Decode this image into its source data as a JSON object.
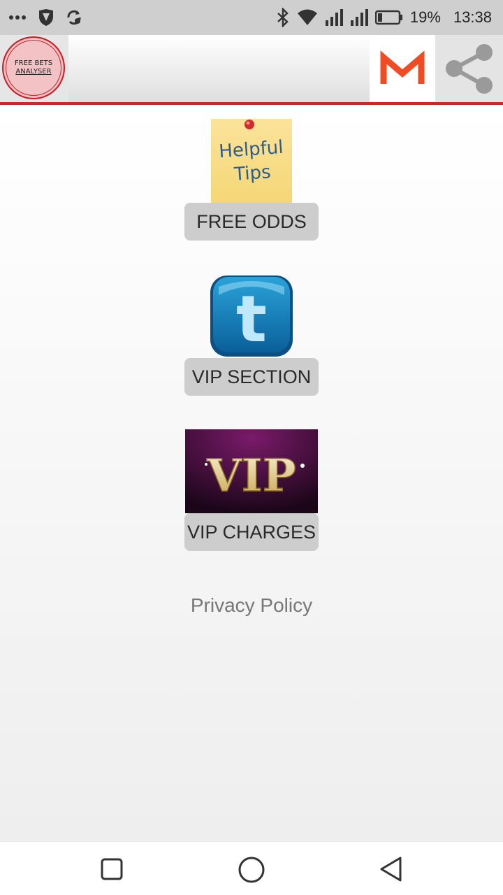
{
  "status_bar": {
    "left_icons": [
      "more-dots-icon",
      "shield-icon",
      "sync-icon"
    ],
    "right_icons": [
      "bluetooth-icon",
      "wifi-icon",
      "signal-icon",
      "signal-icon",
      "battery-icon"
    ],
    "battery": "19%",
    "time": "13:38"
  },
  "app_bar": {
    "logo_line1": "FREE BETS",
    "logo_line2": "ANALYSER",
    "accent_color": "#e0201c",
    "gmail_icon": "gmail-icon",
    "share_icon": "share-icon"
  },
  "menu": [
    {
      "image_text_1": "Helpful",
      "image_text_2": "Tips",
      "label": "FREE ODDS"
    },
    {
      "image_letter": "t",
      "label": "VIP SECTION"
    },
    {
      "image_text": "VIP",
      "label": "VIP CHARGES"
    }
  ],
  "privacy_policy": "Privacy Policy",
  "nav_bar": {
    "icons": [
      "recents-square-icon",
      "home-circle-icon",
      "back-triangle-icon"
    ]
  }
}
